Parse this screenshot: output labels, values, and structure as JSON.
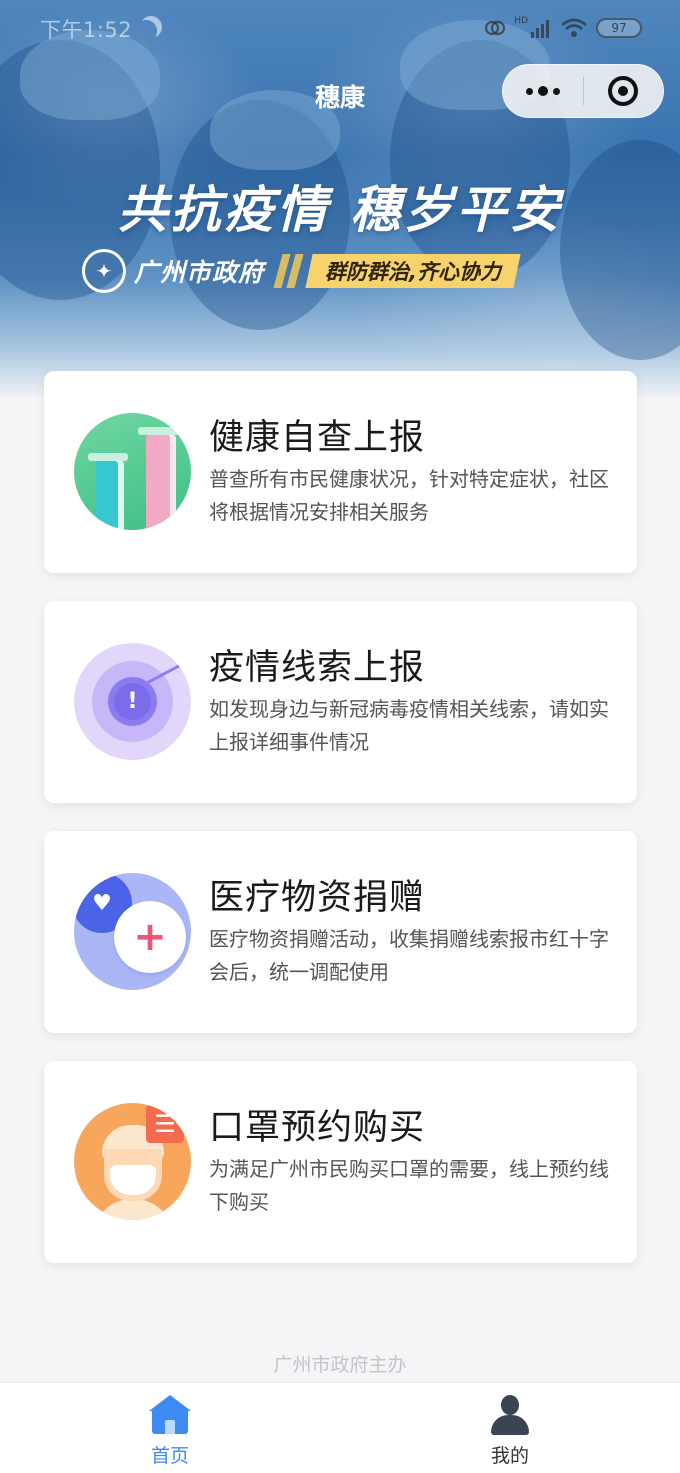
{
  "status_bar": {
    "time": "下午1:52",
    "network": "HD",
    "battery": "97"
  },
  "nav": {
    "title": "穗康"
  },
  "banner": {
    "slogan": "共抗疫情 穗岁平安",
    "gov_name": "广州市政府",
    "tagline": "群防群治,齐心协力"
  },
  "cards": [
    {
      "title": "健康自查上报",
      "description": "普查所有市民健康状况，针对特定症状，社区将根据情况安排相关服务",
      "icon": "health-check-icon"
    },
    {
      "title": "疫情线索上报",
      "description": "如发现身边与新冠病毒疫情相关线索，请如实上报详细事件情况",
      "icon": "clue-report-icon"
    },
    {
      "title": "医疗物资捐赠",
      "description": "医疗物资捐赠活动，收集捐赠线索报市红十字会后，统一调配使用",
      "icon": "donation-icon"
    },
    {
      "title": "口罩预约购买",
      "description": "为满足广州市民购买口罩的需要，线上预约线下购买",
      "icon": "mask-icon"
    }
  ],
  "footer": {
    "sponsor": "广州市政府主办"
  },
  "tabbar": {
    "items": [
      {
        "label": "首页",
        "icon": "home-icon",
        "active": true
      },
      {
        "label": "我的",
        "icon": "user-icon",
        "active": false
      }
    ]
  },
  "colors": {
    "accent": "#3d8bf2",
    "tagline_bg": "#f7d36b",
    "page_bg": "#f4f5f7"
  }
}
